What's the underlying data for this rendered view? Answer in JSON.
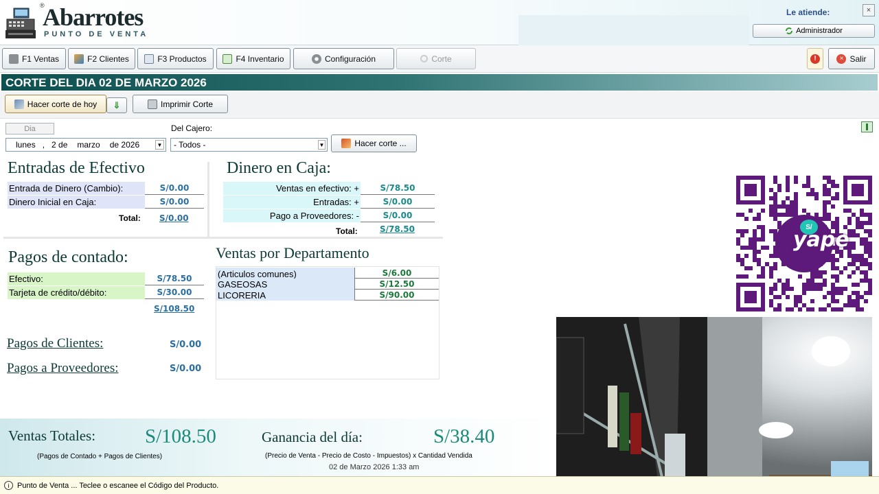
{
  "header": {
    "logo": "Abarrotes",
    "logo_sub": "PUNTO DE VENTA",
    "registered": "®",
    "attends_label": "Le atiende:",
    "user": "Administrador",
    "close": "×"
  },
  "toolbar": {
    "items": [
      {
        "label": "F1 Ventas"
      },
      {
        "label": "F2 Clientes"
      },
      {
        "label": "F3 Productos"
      },
      {
        "label": "F4 Inventario"
      },
      {
        "label": "Configuración"
      },
      {
        "label": "Corte"
      }
    ],
    "exit": "Salir"
  },
  "page": {
    "title": "CORTE DEL DIA 02 DE MARZO 2026",
    "do_cut_today": "Hacer corte de hoy",
    "print_cut": "Imprimir Corte",
    "tab_day": "Dia",
    "cashier_label": "Del Cajero:",
    "date": {
      "weekday": "lunes",
      "sep": ",",
      "day": "2 de",
      "month": "marzo",
      "year": "de 2026"
    },
    "cashier_value": "- Todos -",
    "do_cut": "Hacer corte ..."
  },
  "cash_in": {
    "title": "Entradas de Efectivo",
    "rows": [
      {
        "label": "Entrada de Dinero (Cambio):",
        "value": "S/0.00"
      },
      {
        "label": "Dinero Inicial en Caja:",
        "value": "S/0.00"
      }
    ],
    "total_label": "Total:",
    "total": "S/0.00"
  },
  "in_box": {
    "title": "Dinero en Caja:",
    "rows": [
      {
        "label": "Ventas en efectivo: +",
        "value": "S/78.50"
      },
      {
        "label": "Entradas: +",
        "value": "S/0.00"
      },
      {
        "label": "Pago a Proveedores: -",
        "value": "S/0.00"
      }
    ],
    "total_label": "Total:",
    "total": "S/78.50"
  },
  "cash_pay": {
    "title": "Pagos de contado:",
    "rows": [
      {
        "label": "Efectivo:",
        "value": "S/78.50"
      },
      {
        "label": "Tarjeta de crédito/débito:",
        "value": "S/30.00"
      }
    ],
    "total": "S/108.50"
  },
  "clients": {
    "label": "Pagos de Clientes:",
    "value": "S/0.00"
  },
  "suppliers": {
    "label": "Pagos a Proveedores:",
    "value": "S/0.00"
  },
  "dept": {
    "title": "Ventas por Departamento",
    "rows": [
      {
        "label": "(Articulos comunes)",
        "value": "S/6.00"
      },
      {
        "label": "GASEOSAS",
        "value": "S/12.50"
      },
      {
        "label": "LICORERIA",
        "value": "S/90.00"
      }
    ]
  },
  "totals": {
    "sales_label": "Ventas Totales:",
    "sales": "S/108.50",
    "sales_note": "(Pagos de Contado + Pagos de Clientes)",
    "profit_label": "Ganancia del día:",
    "profit": "S/38.40",
    "profit_note": "(Precio de Venta - Precio de Costo - Impuestos) x Cantidad Vendida",
    "timestamp": "02 de Marzo 2026 1:33 am"
  },
  "status": {
    "text": "Punto de Venta ... Teclee o escanee el Código del Producto."
  },
  "qr": {
    "brand": "yape",
    "badge": "S/"
  },
  "colors": {
    "title_dark": "#0e4f4f",
    "qr_purple": "#5d1a7a",
    "status_bg": "#fbfbe8"
  }
}
